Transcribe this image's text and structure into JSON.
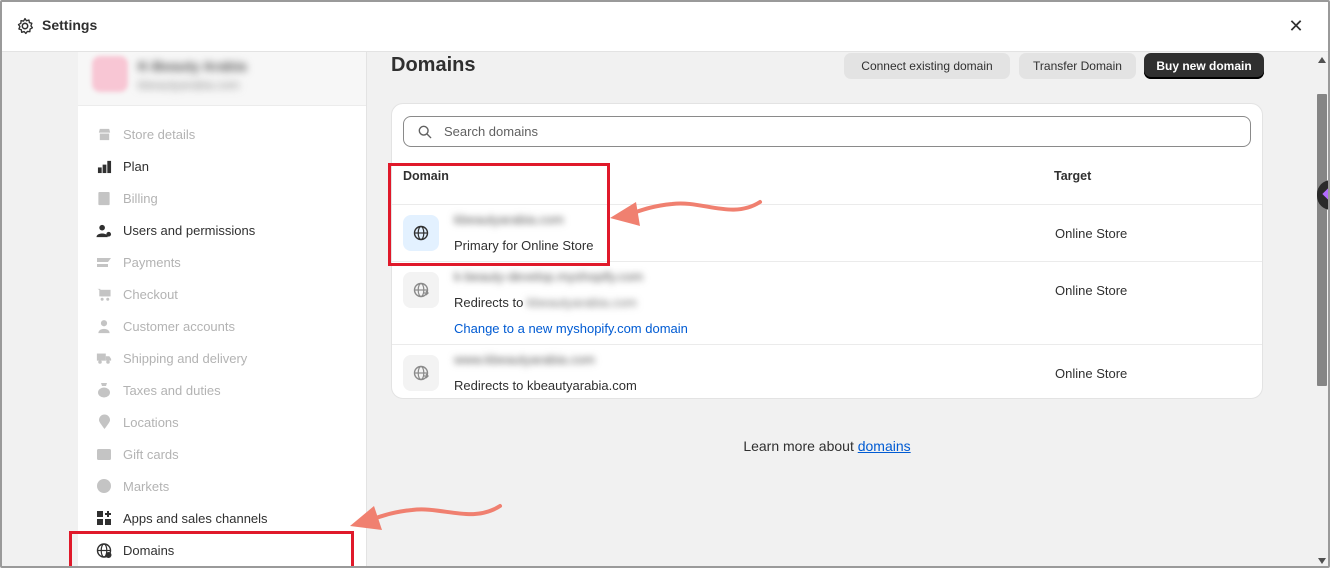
{
  "window": {
    "title": "Settings",
    "close_icon": "close-icon"
  },
  "sidebar": {
    "store": {
      "name": "K-Beauty Arabia",
      "email": "kbeautyarabia.com"
    },
    "items": [
      {
        "label": "Store details",
        "icon": "store-icon",
        "state": "dim"
      },
      {
        "label": "Plan",
        "icon": "plan-icon",
        "state": "active"
      },
      {
        "label": "Billing",
        "icon": "billing-icon",
        "state": "dim"
      },
      {
        "label": "Users and permissions",
        "icon": "users-icon",
        "state": "active"
      },
      {
        "label": "Payments",
        "icon": "payments-icon",
        "state": "dim"
      },
      {
        "label": "Checkout",
        "icon": "cart-icon",
        "state": "dim"
      },
      {
        "label": "Customer accounts",
        "icon": "person-icon",
        "state": "dim"
      },
      {
        "label": "Shipping and delivery",
        "icon": "truck-icon",
        "state": "dim"
      },
      {
        "label": "Taxes and duties",
        "icon": "tax-icon",
        "state": "dim"
      },
      {
        "label": "Locations",
        "icon": "location-icon",
        "state": "dim"
      },
      {
        "label": "Gift cards",
        "icon": "gift-card-icon",
        "state": "dim"
      },
      {
        "label": "Markets",
        "icon": "globe-icon",
        "state": "dim"
      },
      {
        "label": "Apps and sales channels",
        "icon": "apps-icon",
        "state": "active"
      },
      {
        "label": "Domains",
        "icon": "globe-icon",
        "state": "active"
      }
    ]
  },
  "main": {
    "title": "Domains",
    "buttons": {
      "connect": "Connect existing domain",
      "transfer": "Transfer Domain",
      "buy": "Buy new domain"
    },
    "search": {
      "placeholder": "Search domains"
    },
    "table": {
      "headers": {
        "domain": "Domain",
        "target": "Target"
      },
      "rows": [
        {
          "domain": "kbeautyarabia.com",
          "subtitle": "Primary for Online Store",
          "target": "Online Store"
        },
        {
          "domain": "k-beauty-develop.myshopify.com",
          "subtitle": "Redirects to",
          "subtitle_blurred": "kbeautyarabia.com",
          "link": "Change to a new myshopify.com domain",
          "target": "Online Store"
        },
        {
          "domain": "www.kbeautyarabia.com",
          "subtitle": "Redirects to kbeautyarabia.com",
          "target": "Online Store"
        }
      ]
    },
    "learn_more": {
      "prefix": "Learn more about ",
      "link": "domains"
    }
  },
  "colors": {
    "accent_link": "#005bd3",
    "primary_button": "#303030",
    "annotation": "#e0192a",
    "annotation_arrow": "#f08070"
  }
}
